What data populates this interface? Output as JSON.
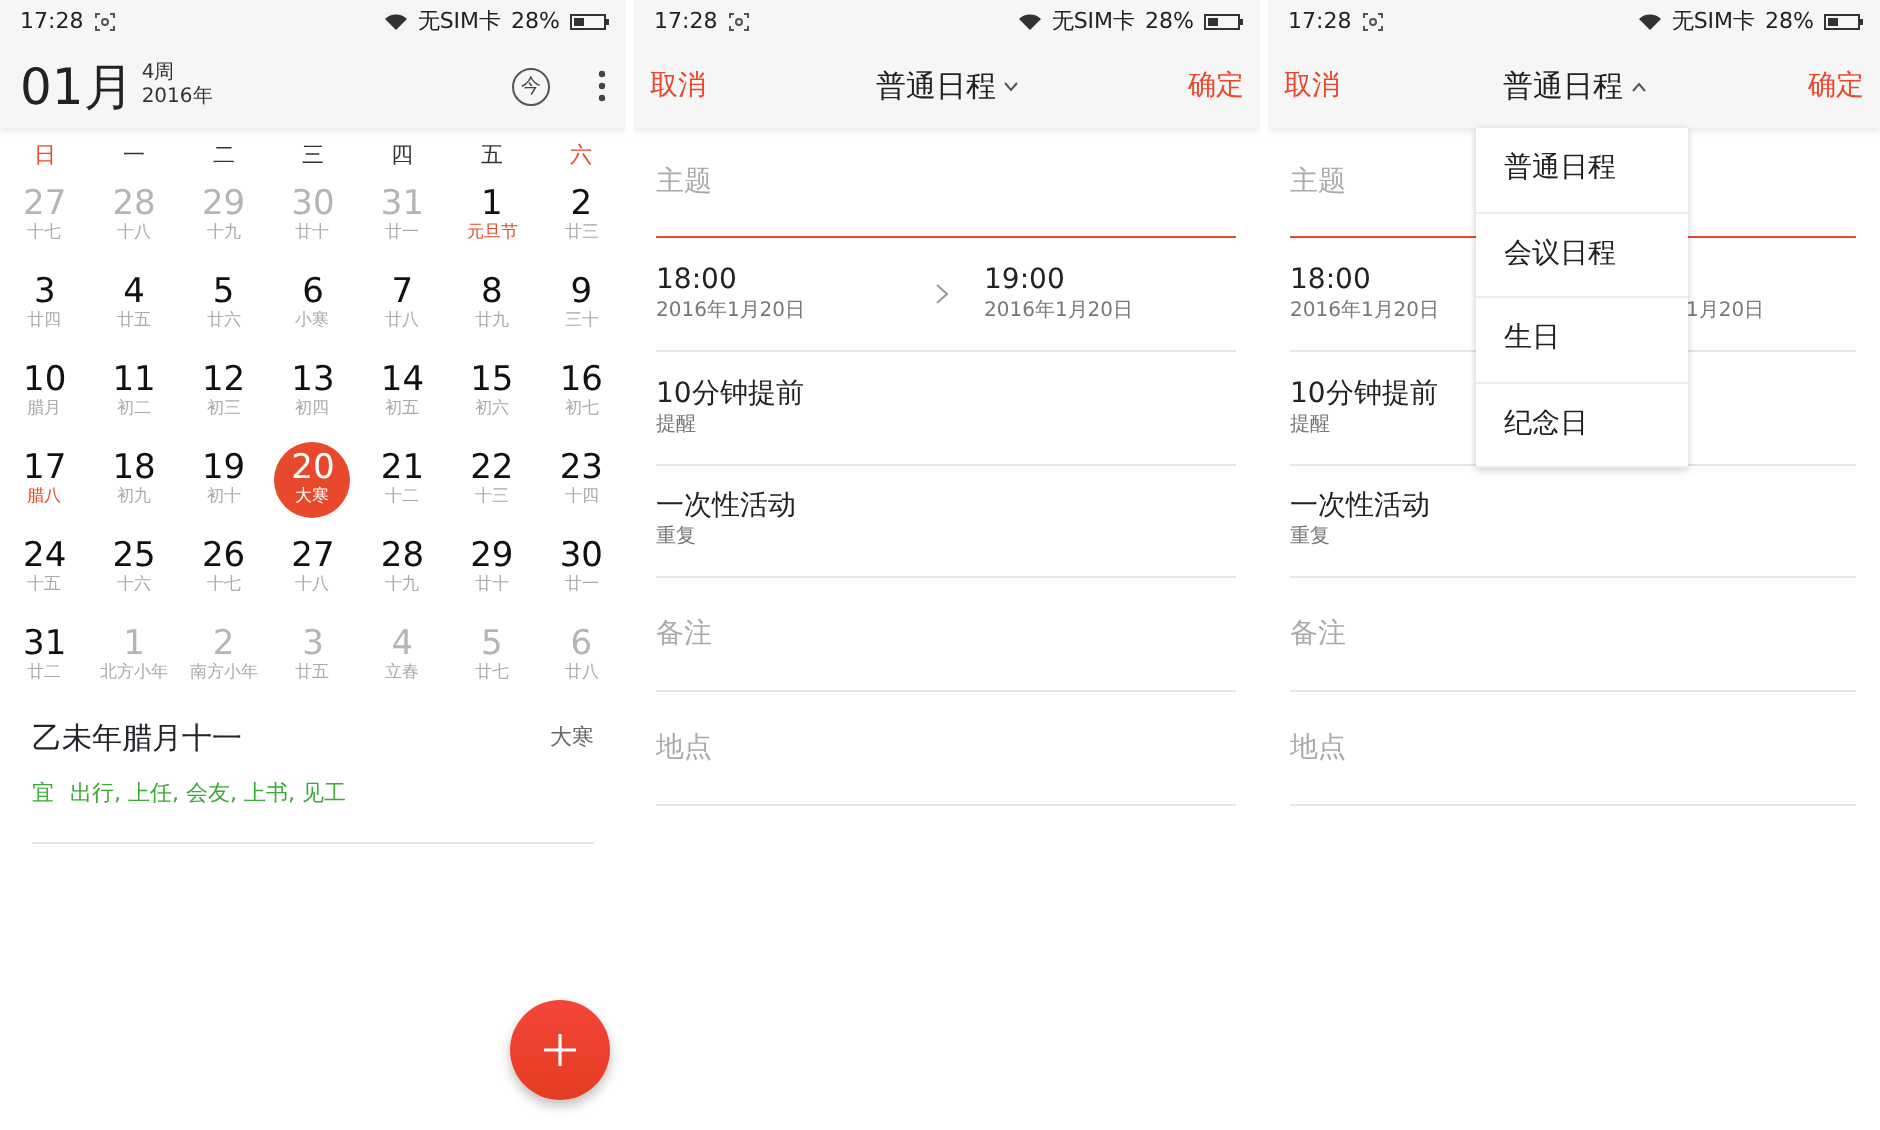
{
  "screens": [
    {
      "kind": "calendar",
      "status_bar": {
        "time": "17:28",
        "carrier": "无SIM卡",
        "battery": "28%"
      },
      "header": {
        "month": "01月",
        "week": "4周",
        "year": "2016年",
        "today_button": "今"
      },
      "weekdays": [
        {
          "label": "日",
          "weekend": true
        },
        {
          "label": "一",
          "weekend": false
        },
        {
          "label": "二",
          "weekend": false
        },
        {
          "label": "三",
          "weekend": false
        },
        {
          "label": "四",
          "weekend": false
        },
        {
          "label": "五",
          "weekend": false
        },
        {
          "label": "六",
          "weekend": true
        }
      ],
      "weeks": [
        [
          {
            "day": "27",
            "lunar": "十七",
            "muted": true,
            "festival": false,
            "selected": false
          },
          {
            "day": "28",
            "lunar": "十八",
            "muted": true,
            "festival": false,
            "selected": false
          },
          {
            "day": "29",
            "lunar": "十九",
            "muted": true,
            "festival": false,
            "selected": false
          },
          {
            "day": "30",
            "lunar": "廿十",
            "muted": true,
            "festival": false,
            "selected": false
          },
          {
            "day": "31",
            "lunar": "廿一",
            "muted": true,
            "festival": false,
            "selected": false
          },
          {
            "day": "1",
            "lunar": "元旦节",
            "muted": false,
            "festival": true,
            "selected": false
          },
          {
            "day": "2",
            "lunar": "廿三",
            "muted": false,
            "festival": false,
            "selected": false
          }
        ],
        [
          {
            "day": "3",
            "lunar": "廿四",
            "muted": false,
            "festival": false,
            "selected": false
          },
          {
            "day": "4",
            "lunar": "廿五",
            "muted": false,
            "festival": false,
            "selected": false
          },
          {
            "day": "5",
            "lunar": "廿六",
            "muted": false,
            "festival": false,
            "selected": false
          },
          {
            "day": "6",
            "lunar": "小寒",
            "muted": false,
            "festival": false,
            "selected": false
          },
          {
            "day": "7",
            "lunar": "廿八",
            "muted": false,
            "festival": false,
            "selected": false
          },
          {
            "day": "8",
            "lunar": "廿九",
            "muted": false,
            "festival": false,
            "selected": false
          },
          {
            "day": "9",
            "lunar": "三十",
            "muted": false,
            "festival": false,
            "selected": false
          }
        ],
        [
          {
            "day": "10",
            "lunar": "腊月",
            "muted": false,
            "festival": false,
            "selected": false
          },
          {
            "day": "11",
            "lunar": "初二",
            "muted": false,
            "festival": false,
            "selected": false
          },
          {
            "day": "12",
            "lunar": "初三",
            "muted": false,
            "festival": false,
            "selected": false
          },
          {
            "day": "13",
            "lunar": "初四",
            "muted": false,
            "festival": false,
            "selected": false
          },
          {
            "day": "14",
            "lunar": "初五",
            "muted": false,
            "festival": false,
            "selected": false
          },
          {
            "day": "15",
            "lunar": "初六",
            "muted": false,
            "festival": false,
            "selected": false
          },
          {
            "day": "16",
            "lunar": "初七",
            "muted": false,
            "festival": false,
            "selected": false
          }
        ],
        [
          {
            "day": "17",
            "lunar": "腊八",
            "muted": false,
            "festival": true,
            "selected": false
          },
          {
            "day": "18",
            "lunar": "初九",
            "muted": false,
            "festival": false,
            "selected": false
          },
          {
            "day": "19",
            "lunar": "初十",
            "muted": false,
            "festival": false,
            "selected": false
          },
          {
            "day": "20",
            "lunar": "大寒",
            "muted": false,
            "festival": false,
            "selected": true
          },
          {
            "day": "21",
            "lunar": "十二",
            "muted": false,
            "festival": false,
            "selected": false
          },
          {
            "day": "22",
            "lunar": "十三",
            "muted": false,
            "festival": false,
            "selected": false
          },
          {
            "day": "23",
            "lunar": "十四",
            "muted": false,
            "festival": false,
            "selected": false
          }
        ],
        [
          {
            "day": "24",
            "lunar": "十五",
            "muted": false,
            "festival": false,
            "selected": false
          },
          {
            "day": "25",
            "lunar": "十六",
            "muted": false,
            "festival": false,
            "selected": false
          },
          {
            "day": "26",
            "lunar": "十七",
            "muted": false,
            "festival": false,
            "selected": false
          },
          {
            "day": "27",
            "lunar": "十八",
            "muted": false,
            "festival": false,
            "selected": false
          },
          {
            "day": "28",
            "lunar": "十九",
            "muted": false,
            "festival": false,
            "selected": false
          },
          {
            "day": "29",
            "lunar": "廿十",
            "muted": false,
            "festival": false,
            "selected": false
          },
          {
            "day": "30",
            "lunar": "廿一",
            "muted": false,
            "festival": false,
            "selected": false
          }
        ],
        [
          {
            "day": "31",
            "lunar": "廿二",
            "muted": false,
            "festival": false,
            "selected": false
          },
          {
            "day": "1",
            "lunar": "北方小年",
            "muted": true,
            "festival": false,
            "selected": false
          },
          {
            "day": "2",
            "lunar": "南方小年",
            "muted": true,
            "festival": false,
            "selected": false
          },
          {
            "day": "3",
            "lunar": "廿五",
            "muted": true,
            "festival": false,
            "selected": false
          },
          {
            "day": "4",
            "lunar": "立春",
            "muted": true,
            "festival": false,
            "selected": false
          },
          {
            "day": "5",
            "lunar": "廿七",
            "muted": true,
            "festival": false,
            "selected": false
          },
          {
            "day": "6",
            "lunar": "廿八",
            "muted": true,
            "festival": false,
            "selected": false
          }
        ]
      ],
      "lunar_date": "乙未年腊月十一",
      "solar_term": "大寒",
      "fortune": {
        "label": "宜",
        "items": "出行, 上任, 会友, 上书, 见工"
      }
    },
    {
      "kind": "event_form",
      "status_bar": {
        "time": "17:28",
        "carrier": "无SIM卡",
        "battery": "28%"
      },
      "cancel": "取消",
      "title": "普通日程",
      "expanded": false,
      "confirm": "确定",
      "subject_placeholder": "主题",
      "start": {
        "time": "18:00",
        "date": "2016年1月20日"
      },
      "end": {
        "time": "19:00",
        "date": "2016年1月20日"
      },
      "rows": [
        {
          "value": "10分钟提前",
          "label": "提醒"
        },
        {
          "value": "一次性活动",
          "label": "重复"
        }
      ],
      "notes_placeholder": "备注",
      "location_placeholder": "地点"
    },
    {
      "kind": "event_form",
      "status_bar": {
        "time": "17:28",
        "carrier": "无SIM卡",
        "battery": "28%"
      },
      "cancel": "取消",
      "title": "普通日程",
      "expanded": true,
      "confirm": "确定",
      "subject_placeholder": "主题",
      "start": {
        "time": "18:00",
        "date": "2016年1月20日"
      },
      "end": {
        "date": "1月20日"
      },
      "rows": [
        {
          "value": "10分钟提前",
          "label": "提醒"
        },
        {
          "value": "一次性活动",
          "label": "重复"
        }
      ],
      "notes_placeholder": "备注",
      "location_placeholder": "地点",
      "menu": [
        {
          "label": "普通日程"
        },
        {
          "label": "会议日程"
        },
        {
          "label": "生日"
        },
        {
          "label": "纪念日"
        }
      ]
    }
  ]
}
